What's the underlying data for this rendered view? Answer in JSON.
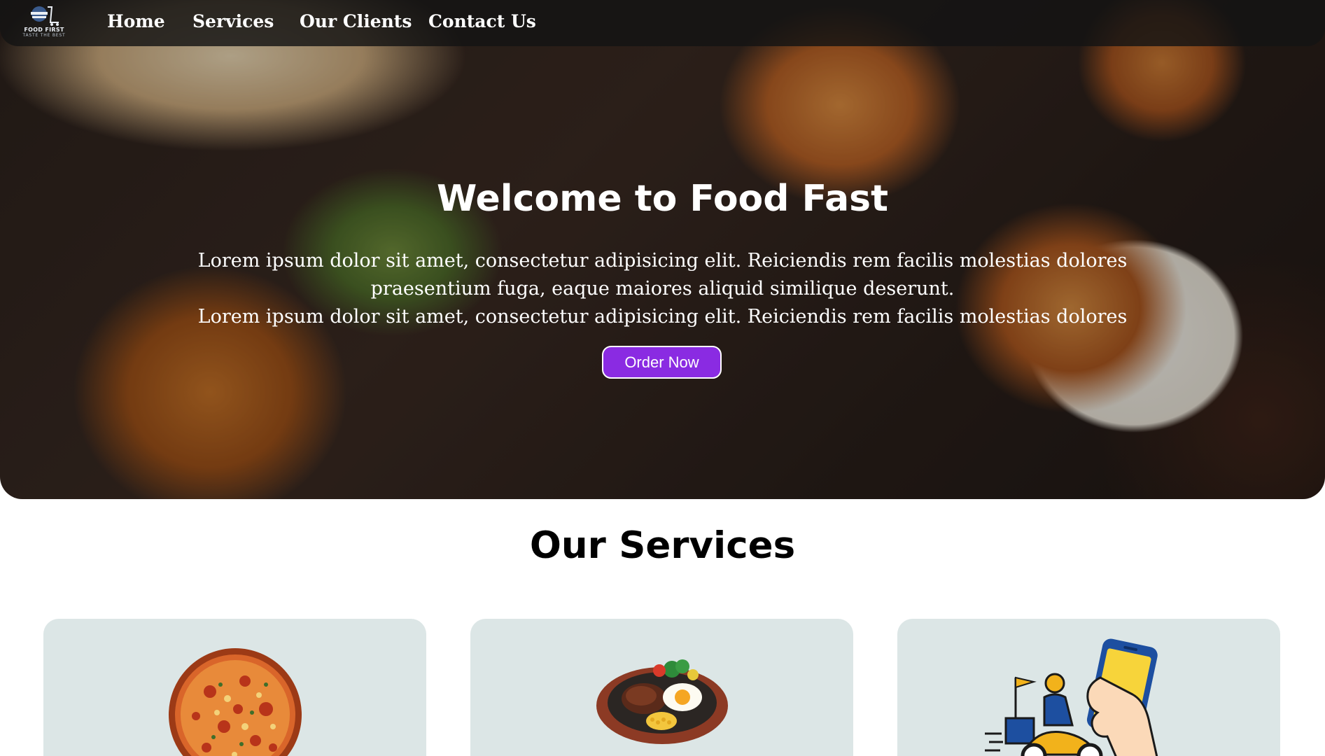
{
  "nav": {
    "logo": {
      "title": "FOOD FIRST",
      "tagline": "TASTE THE BEST"
    },
    "items": [
      {
        "label": "Home"
      },
      {
        "label": "Services"
      },
      {
        "label": "Our Clients"
      },
      {
        "label": "Contact Us"
      }
    ]
  },
  "hero": {
    "title": "Welcome to Food Fast",
    "lines": [
      "Lorem ipsum dolor sit amet, consectetur adipisicing elit. Reiciendis rem facilis molestias dolores",
      "praesentium fuga, eaque maiores aliquid similique deserunt.",
      "Lorem ipsum dolor sit amet, consectetur adipisicing elit. Reiciendis rem facilis molestias dolores"
    ],
    "button_label": "Order Now"
  },
  "services": {
    "title": "Our Services",
    "cards": [
      {
        "image": "pizza-image"
      },
      {
        "image": "sizzler-plate-image"
      },
      {
        "image": "delivery-scooter-image"
      }
    ]
  },
  "colors": {
    "accent": "#8a2be2",
    "card_bg": "#dce6e6",
    "navbar_bg": "#141414"
  }
}
